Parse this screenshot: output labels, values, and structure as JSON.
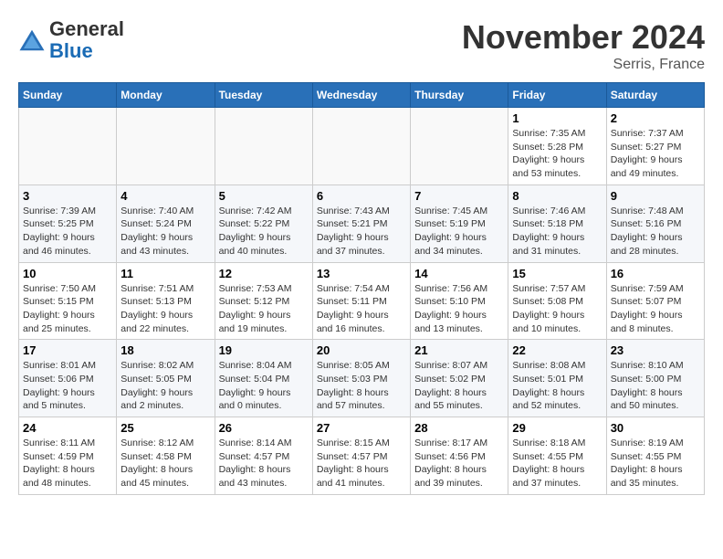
{
  "logo": {
    "general": "General",
    "blue": "Blue"
  },
  "title": "November 2024",
  "subtitle": "Serris, France",
  "weekdays": [
    "Sunday",
    "Monday",
    "Tuesday",
    "Wednesday",
    "Thursday",
    "Friday",
    "Saturday"
  ],
  "weeks": [
    [
      {
        "day": "",
        "info": ""
      },
      {
        "day": "",
        "info": ""
      },
      {
        "day": "",
        "info": ""
      },
      {
        "day": "",
        "info": ""
      },
      {
        "day": "",
        "info": ""
      },
      {
        "day": "1",
        "info": "Sunrise: 7:35 AM\nSunset: 5:28 PM\nDaylight: 9 hours and 53 minutes."
      },
      {
        "day": "2",
        "info": "Sunrise: 7:37 AM\nSunset: 5:27 PM\nDaylight: 9 hours and 49 minutes."
      }
    ],
    [
      {
        "day": "3",
        "info": "Sunrise: 7:39 AM\nSunset: 5:25 PM\nDaylight: 9 hours and 46 minutes."
      },
      {
        "day": "4",
        "info": "Sunrise: 7:40 AM\nSunset: 5:24 PM\nDaylight: 9 hours and 43 minutes."
      },
      {
        "day": "5",
        "info": "Sunrise: 7:42 AM\nSunset: 5:22 PM\nDaylight: 9 hours and 40 minutes."
      },
      {
        "day": "6",
        "info": "Sunrise: 7:43 AM\nSunset: 5:21 PM\nDaylight: 9 hours and 37 minutes."
      },
      {
        "day": "7",
        "info": "Sunrise: 7:45 AM\nSunset: 5:19 PM\nDaylight: 9 hours and 34 minutes."
      },
      {
        "day": "8",
        "info": "Sunrise: 7:46 AM\nSunset: 5:18 PM\nDaylight: 9 hours and 31 minutes."
      },
      {
        "day": "9",
        "info": "Sunrise: 7:48 AM\nSunset: 5:16 PM\nDaylight: 9 hours and 28 minutes."
      }
    ],
    [
      {
        "day": "10",
        "info": "Sunrise: 7:50 AM\nSunset: 5:15 PM\nDaylight: 9 hours and 25 minutes."
      },
      {
        "day": "11",
        "info": "Sunrise: 7:51 AM\nSunset: 5:13 PM\nDaylight: 9 hours and 22 minutes."
      },
      {
        "day": "12",
        "info": "Sunrise: 7:53 AM\nSunset: 5:12 PM\nDaylight: 9 hours and 19 minutes."
      },
      {
        "day": "13",
        "info": "Sunrise: 7:54 AM\nSunset: 5:11 PM\nDaylight: 9 hours and 16 minutes."
      },
      {
        "day": "14",
        "info": "Sunrise: 7:56 AM\nSunset: 5:10 PM\nDaylight: 9 hours and 13 minutes."
      },
      {
        "day": "15",
        "info": "Sunrise: 7:57 AM\nSunset: 5:08 PM\nDaylight: 9 hours and 10 minutes."
      },
      {
        "day": "16",
        "info": "Sunrise: 7:59 AM\nSunset: 5:07 PM\nDaylight: 9 hours and 8 minutes."
      }
    ],
    [
      {
        "day": "17",
        "info": "Sunrise: 8:01 AM\nSunset: 5:06 PM\nDaylight: 9 hours and 5 minutes."
      },
      {
        "day": "18",
        "info": "Sunrise: 8:02 AM\nSunset: 5:05 PM\nDaylight: 9 hours and 2 minutes."
      },
      {
        "day": "19",
        "info": "Sunrise: 8:04 AM\nSunset: 5:04 PM\nDaylight: 9 hours and 0 minutes."
      },
      {
        "day": "20",
        "info": "Sunrise: 8:05 AM\nSunset: 5:03 PM\nDaylight: 8 hours and 57 minutes."
      },
      {
        "day": "21",
        "info": "Sunrise: 8:07 AM\nSunset: 5:02 PM\nDaylight: 8 hours and 55 minutes."
      },
      {
        "day": "22",
        "info": "Sunrise: 8:08 AM\nSunset: 5:01 PM\nDaylight: 8 hours and 52 minutes."
      },
      {
        "day": "23",
        "info": "Sunrise: 8:10 AM\nSunset: 5:00 PM\nDaylight: 8 hours and 50 minutes."
      }
    ],
    [
      {
        "day": "24",
        "info": "Sunrise: 8:11 AM\nSunset: 4:59 PM\nDaylight: 8 hours and 48 minutes."
      },
      {
        "day": "25",
        "info": "Sunrise: 8:12 AM\nSunset: 4:58 PM\nDaylight: 8 hours and 45 minutes."
      },
      {
        "day": "26",
        "info": "Sunrise: 8:14 AM\nSunset: 4:57 PM\nDaylight: 8 hours and 43 minutes."
      },
      {
        "day": "27",
        "info": "Sunrise: 8:15 AM\nSunset: 4:57 PM\nDaylight: 8 hours and 41 minutes."
      },
      {
        "day": "28",
        "info": "Sunrise: 8:17 AM\nSunset: 4:56 PM\nDaylight: 8 hours and 39 minutes."
      },
      {
        "day": "29",
        "info": "Sunrise: 8:18 AM\nSunset: 4:55 PM\nDaylight: 8 hours and 37 minutes."
      },
      {
        "day": "30",
        "info": "Sunrise: 8:19 AM\nSunset: 4:55 PM\nDaylight: 8 hours and 35 minutes."
      }
    ]
  ]
}
